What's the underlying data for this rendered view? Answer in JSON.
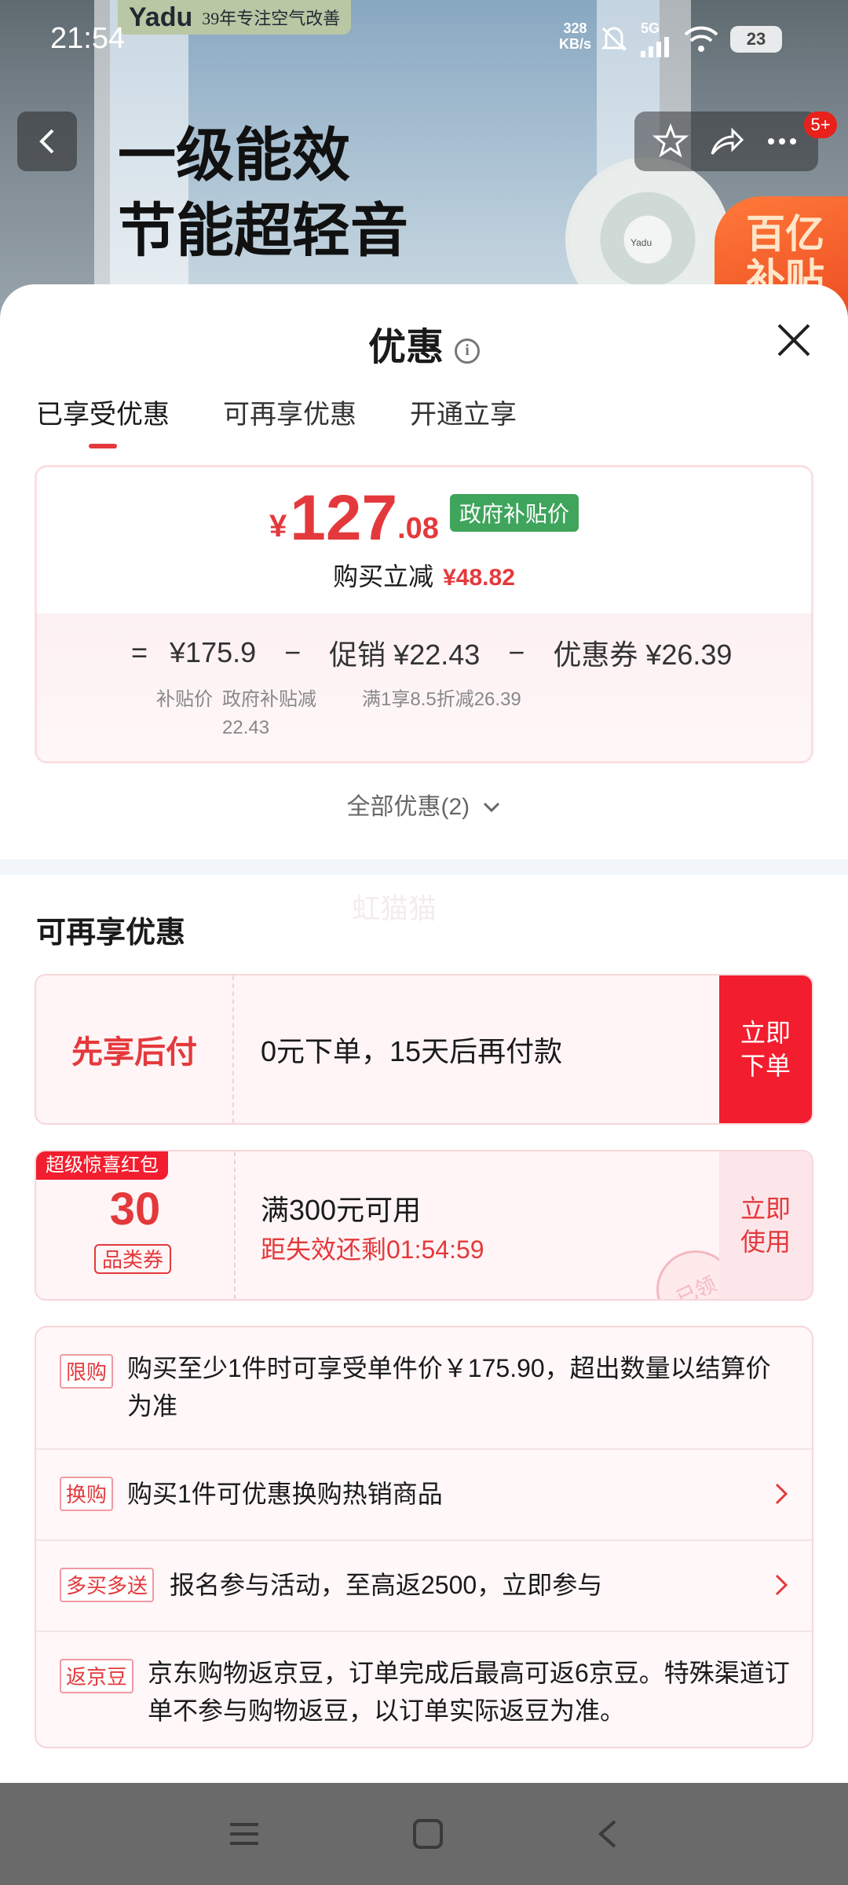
{
  "status_bar": {
    "time": "21:54",
    "net_speed": "328",
    "net_unit": "KB/s",
    "network_type": "5G",
    "battery": "23"
  },
  "background": {
    "brand_logo": "Yadu",
    "brand_slogan": "39年专注空气改善",
    "headline_line1": "一级能效",
    "headline_line2": "节能超轻音",
    "fan_label": "Yadu",
    "subsidy_line1": "百亿",
    "subsidy_line2": "补贴"
  },
  "top_nav": {
    "badge": "5+"
  },
  "sheet": {
    "title": "优惠",
    "info_glyph": "i",
    "tabs": [
      {
        "label": "已享受优惠",
        "active": true
      },
      {
        "label": "可再享优惠",
        "active": false
      },
      {
        "label": "开通立享",
        "active": false
      }
    ]
  },
  "price_card": {
    "currency": "¥",
    "integer": "127",
    "decimal": ".08",
    "tag": "政府补贴价",
    "reduce_label": "购买立减",
    "reduce_amount": "¥48.82",
    "equals": "=",
    "base_price": "¥175.9",
    "minus1": "−",
    "promo_label": "促销 ¥22.43",
    "minus2": "−",
    "coupon_label": "优惠券 ¥26.39",
    "base_sub": "补贴价",
    "promo_sub_1": "政府补贴减",
    "promo_sub_2": "22.43",
    "coupon_sub": "满1享8.5折减26.39"
  },
  "all_offers": "全部优惠(2)",
  "watermark": "虹猫猫",
  "more_offers": {
    "title": "可再享优惠",
    "bnpl": {
      "label": "先享后付",
      "desc": "0元下单，15天后再付款",
      "btn_line1": "立即",
      "btn_line2": "下单"
    },
    "coupon": {
      "ribbon": "超级惊喜红包",
      "value": "30",
      "kind": "品类券",
      "condition": "满300元可用",
      "expire": "距失效还剩01:54:59",
      "btn_line1": "立即",
      "btn_line2": "使用",
      "stamp": "已领"
    }
  },
  "promotions": [
    {
      "tag": "限购",
      "text": "购买至少1件时可享受单件价￥175.90，超出数量以结算价为准",
      "has_arrow": false
    },
    {
      "tag": "换购",
      "text": "购买1件可优惠换购热销商品",
      "has_arrow": true
    },
    {
      "tag": "多买多送",
      "text": "报名参与活动，至高返2500，立即参与",
      "has_arrow": true
    },
    {
      "tag": "返京豆",
      "text": "京东购物返京豆，订单完成后最高可返6京豆。特殊渠道订单不参与购物返豆，以订单实际返豆为准。",
      "has_arrow": false
    }
  ],
  "colors": {
    "accent_red": "#e4393c",
    "button_red": "#f21d2e",
    "gov_green": "#3fa45c"
  }
}
